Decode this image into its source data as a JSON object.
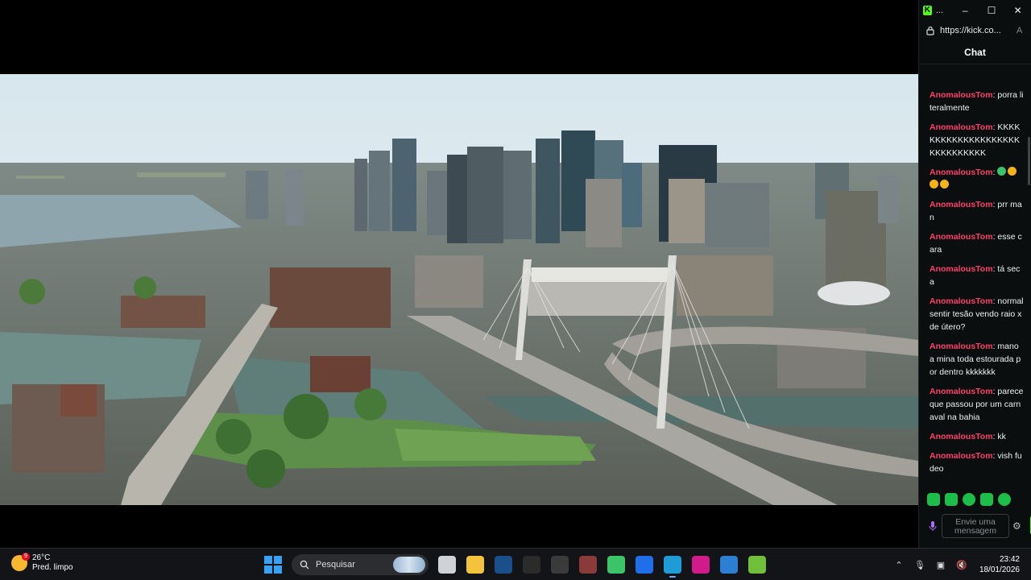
{
  "window": {
    "app_title": "...",
    "url": "https://kick.co...",
    "chat_header": "Chat"
  },
  "chat": {
    "username": "AnomalousTom",
    "messages": [
      {
        "user": "AnomalousTom",
        "text": "porra literalmente"
      },
      {
        "user": "AnomalousTom",
        "text": "KKKKKKKKKKKKKKKKKKKKKKKKKKKKKK"
      },
      {
        "user": "AnomalousTom",
        "text": "",
        "emotes": [
          "green",
          "yellow",
          "yellow",
          "yellow"
        ]
      },
      {
        "user": "AnomalousTom",
        "text": "prr man"
      },
      {
        "user": "AnomalousTom",
        "text": "esse cara"
      },
      {
        "user": "AnomalousTom",
        "text": "tá seca"
      },
      {
        "user": "AnomalousTom",
        "text": "normal sentir tesão vendo raio x de útero?"
      },
      {
        "user": "AnomalousTom",
        "text": "mano a mina toda estourada por dentro kkkkkkk"
      },
      {
        "user": "AnomalousTom",
        "text": "parece que passou por um carnaval na bahia"
      },
      {
        "user": "AnomalousTom",
        "text": "kk"
      },
      {
        "user": "AnomalousTom",
        "text": "vish fudeo"
      }
    ],
    "input_placeholder": "Envie uma mensagem"
  },
  "taskbar": {
    "weather_temp": "26°C",
    "weather_desc": "Pred. limpo",
    "weather_badge": "9",
    "search_placeholder": "Pesquisar",
    "time": "23:42",
    "date": "18/01/2026",
    "apps": [
      {
        "name": "task-view-icon",
        "color": "#cfd3d8"
      },
      {
        "name": "file-explorer-icon",
        "color": "#f3c33b"
      },
      {
        "name": "steam-icon",
        "color": "#1b4f8a"
      },
      {
        "name": "epic-games-icon",
        "color": "#2b2b2b"
      },
      {
        "name": "gear-app-icon",
        "color": "#3a3a3a"
      },
      {
        "name": "game-app-icon",
        "color": "#8b3a3a"
      },
      {
        "name": "android-app-icon",
        "color": "#3cc46b"
      },
      {
        "name": "messenger-icon",
        "color": "#1f6feb"
      },
      {
        "name": "edge-icon",
        "color": "#1f9bd7"
      },
      {
        "name": "notes-app-icon",
        "color": "#d11b8a"
      },
      {
        "name": "photos-icon",
        "color": "#2d7fd3"
      },
      {
        "name": "bluestacks-icon",
        "color": "#6fbf3b"
      }
    ]
  },
  "colors": {
    "username": "#ff3e6c",
    "kick_green": "#53fc18",
    "taskbar_bg": "#121417"
  }
}
